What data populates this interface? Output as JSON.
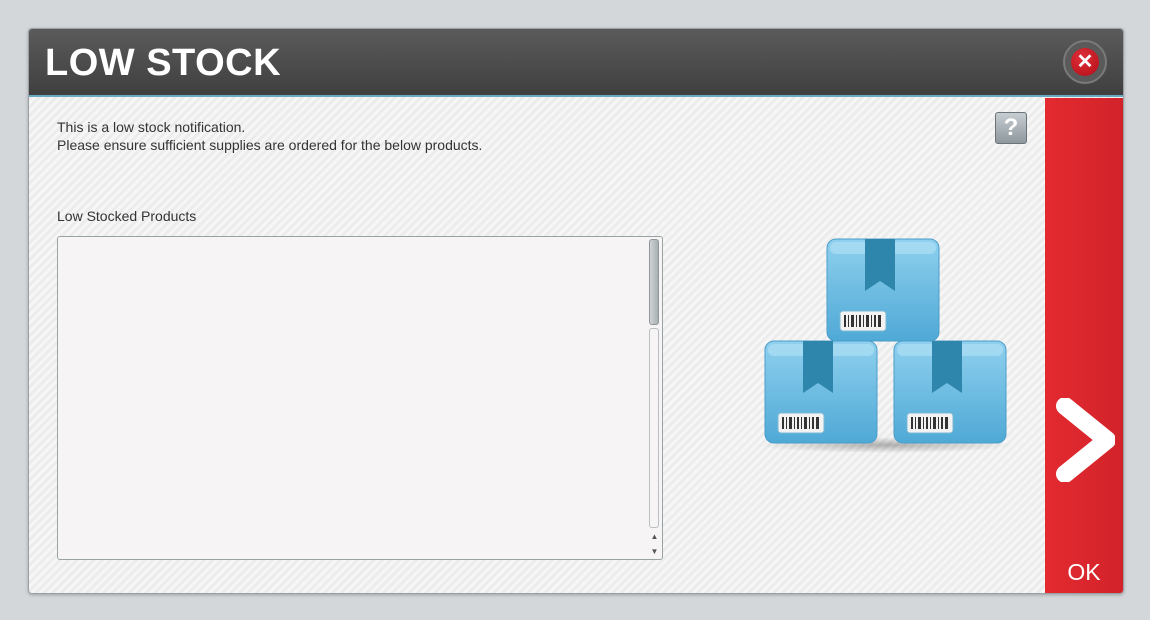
{
  "dialog": {
    "title": "LOW STOCK",
    "close_icon": "close-icon",
    "help_icon": "help-icon",
    "help_label": "?",
    "message_line1": "This is a low stock  notification.",
    "message_line2": "Please ensure sufficient supplies are ordered for the below products.",
    "list_label": "Low Stocked Products",
    "list_items": [],
    "illustration_icon": "stacked-boxes-icon",
    "ok_label": "OK",
    "ok_icon": "chevron-right-icon"
  },
  "colors": {
    "titlebar": "#4a4a4a",
    "accent_line": "#6aa9c2",
    "ok_panel": "#e32a30",
    "box_blue": "#5bb6e0"
  }
}
